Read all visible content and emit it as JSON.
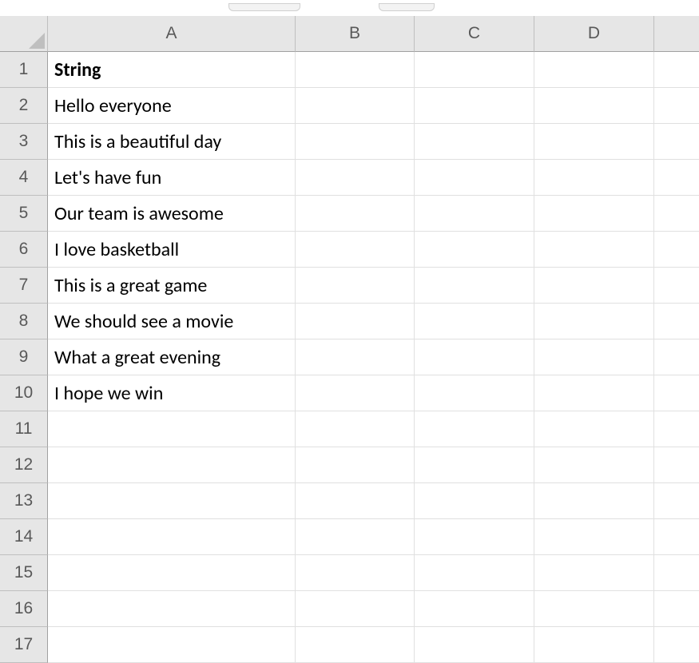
{
  "columns": [
    "A",
    "B",
    "C",
    "D",
    ""
  ],
  "rows": [
    "1",
    "2",
    "3",
    "4",
    "5",
    "6",
    "7",
    "8",
    "9",
    "10",
    "11",
    "12",
    "13",
    "14",
    "15",
    "16",
    "17"
  ],
  "cells": {
    "A1": "String",
    "A2": "Hello everyone",
    "A3": "This is a beautiful day",
    "A4": "Let's have fun",
    "A5": "Our team is awesome",
    "A6": "I love basketball",
    "A7": "This is a great game",
    "A8": "We should see a movie",
    "A9": "What a great evening",
    "A10": "I hope we win"
  }
}
